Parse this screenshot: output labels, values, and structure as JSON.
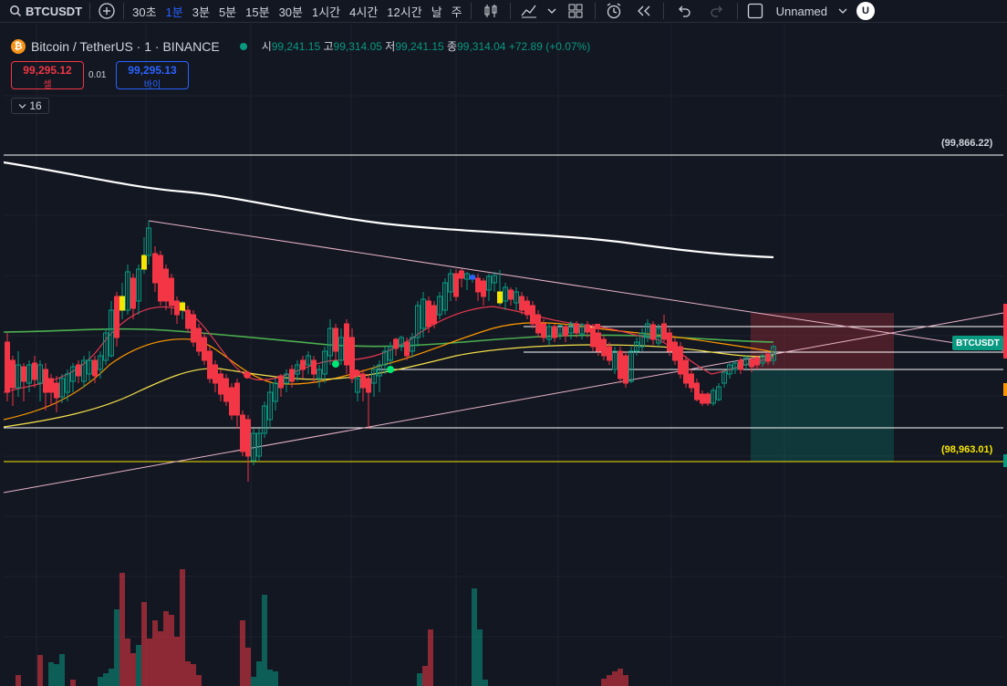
{
  "toolbar": {
    "symbol": "BTCUSDT",
    "intervals": [
      "30초",
      "1분",
      "3분",
      "5분",
      "15분",
      "30분",
      "1시간",
      "4시간",
      "12시간",
      "날",
      "주"
    ],
    "active_interval": "1분",
    "layout_name": "Unnamed",
    "avatar_letter": "U"
  },
  "legend": {
    "title": "Bitcoin / TetherUS · 1 · BINANCE",
    "open_label": "시",
    "open": "99,241.15",
    "high_label": "고",
    "high": "99,314.05",
    "low_label": "저",
    "low": "99,241.15",
    "close_label": "종",
    "close": "99,314.04",
    "change": "+72.89 (+0.07%)"
  },
  "trade": {
    "sell_price": "99,295.12",
    "sell_label": "셀",
    "spread": "0.01",
    "buy_price": "99,295.13",
    "buy_label": "바이"
  },
  "indicators_count": "16",
  "price_labels": {
    "top": "(99,866.22)",
    "bottom": "(98,963.01)",
    "symbol_tag": "BTCUSDT"
  },
  "colors": {
    "background": "#131722",
    "up": "#089981",
    "down": "#f23645",
    "accent": "#2962ff"
  }
}
